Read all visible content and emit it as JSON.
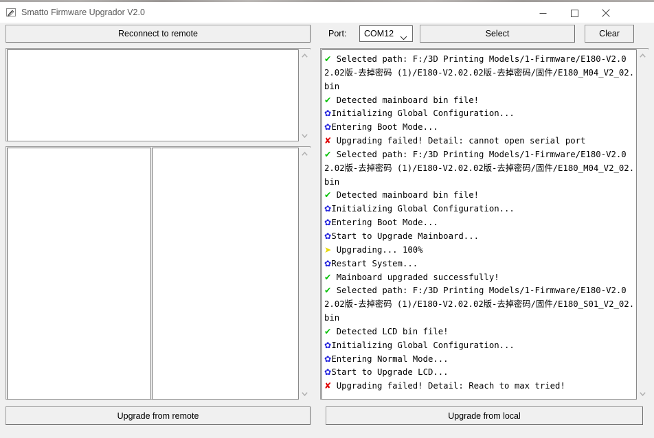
{
  "window": {
    "title": "Smatto Firmware Upgrador V2.0",
    "icon": "app-pencil-icon",
    "controls": {
      "minimize": "minimize-icon",
      "maximize": "maximize-icon",
      "close": "close-icon"
    }
  },
  "toolbar": {
    "reconnect_label": "Reconnect to remote",
    "port_label": "Port:",
    "port_value": "COM12",
    "port_options": [
      "COM12"
    ],
    "port_chevron": "chevron-down-icon",
    "select_label": "Select",
    "clear_label": "Clear"
  },
  "left_panel": {
    "top_list_items": [],
    "bottom_list_a_items": [],
    "bottom_list_b_items": [],
    "upgrade_remote_label": "Upgrade from remote"
  },
  "right_panel": {
    "upgrade_local_label": "Upgrade from local",
    "log": [
      {
        "icon": "check",
        "text": " Selected path: F:/3D Printing Models/1-Firmware/E180-V2.02.02版-去掉密码 (1)/E180-V2.02.02版-去掉密码/固件/E180_M04_V2_02.bin"
      },
      {
        "icon": "check",
        "text": " Detected mainboard bin file!"
      },
      {
        "icon": "gear",
        "text": "Initializing Global Configuration..."
      },
      {
        "icon": "gear",
        "text": "Entering Boot Mode..."
      },
      {
        "icon": "cross",
        "text": " Upgrading failed! Detail: cannot open serial port"
      },
      {
        "icon": "check",
        "text": " Selected path: F:/3D Printing Models/1-Firmware/E180-V2.02.02版-去掉密码 (1)/E180-V2.02.02版-去掉密码/固件/E180_M04_V2_02.bin"
      },
      {
        "icon": "check",
        "text": " Detected mainboard bin file!"
      },
      {
        "icon": "gear",
        "text": "Initializing Global Configuration..."
      },
      {
        "icon": "gear",
        "text": "Entering Boot Mode..."
      },
      {
        "icon": "gear",
        "text": "Start to Upgrade Mainboard..."
      },
      {
        "icon": "arrow",
        "text": " Upgrading... 100%"
      },
      {
        "icon": "gear",
        "text": "Restart System..."
      },
      {
        "icon": "check",
        "text": " Mainboard upgraded successfully!"
      },
      {
        "icon": "check",
        "text": " Selected path: F:/3D Printing Models/1-Firmware/E180-V2.02.02版-去掉密码 (1)/E180-V2.02.02版-去掉密码/固件/E180_S01_V2_02.bin"
      },
      {
        "icon": "check",
        "text": " Detected LCD bin file!"
      },
      {
        "icon": "gear",
        "text": "Initializing Global Configuration..."
      },
      {
        "icon": "gear",
        "text": "Entering Normal Mode..."
      },
      {
        "icon": "gear",
        "text": "Start to Upgrade LCD..."
      },
      {
        "icon": "cross",
        "text": " Upgrading failed! Detail: Reach to max tried!"
      }
    ]
  },
  "icons": {
    "check": {
      "glyph": "✔",
      "color": "#00c000",
      "name": "success-check-icon"
    },
    "gear": {
      "glyph": "✿",
      "color": "#2222dd",
      "name": "processing-gear-icon"
    },
    "cross": {
      "glyph": "✘",
      "color": "#e00000",
      "name": "error-cross-icon"
    },
    "arrow": {
      "glyph": "➤",
      "color": "#e8d800",
      "name": "progress-arrow-icon"
    }
  },
  "colors": {
    "window_bg": "#f0f0f0",
    "listbox_bg": "#ffffff",
    "title_text": "#5a5a5a",
    "border": "#9a9a9a"
  }
}
